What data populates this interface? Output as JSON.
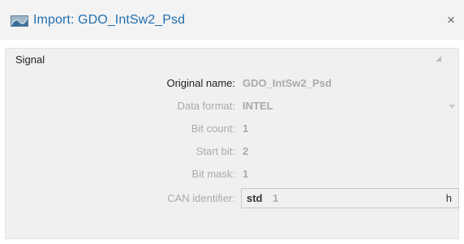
{
  "window": {
    "title": "Import: GDO_IntSw2_Psd",
    "close_glyph": "×",
    "icon": "signal-import-icon"
  },
  "section": {
    "title": "Signal",
    "collapse_icon": "collapse-triangle-icon"
  },
  "properties": [
    {
      "label": "Original name:",
      "value": "GDO_IntSw2_Psd"
    },
    {
      "label": "Data format:",
      "value": "INTEL"
    },
    {
      "label": "Bit count:",
      "value": "1"
    },
    {
      "label": "Start bit:",
      "value": "2"
    },
    {
      "label": "Bit mask:",
      "value": "1"
    }
  ],
  "can": {
    "label": "CAN identifier:",
    "type": "std",
    "value": "1",
    "suffix": "h"
  },
  "colors": {
    "title_text": "#1f6fb0",
    "disabled_text": "#aaaaaa",
    "panel_bg": "#f0f0f0"
  }
}
